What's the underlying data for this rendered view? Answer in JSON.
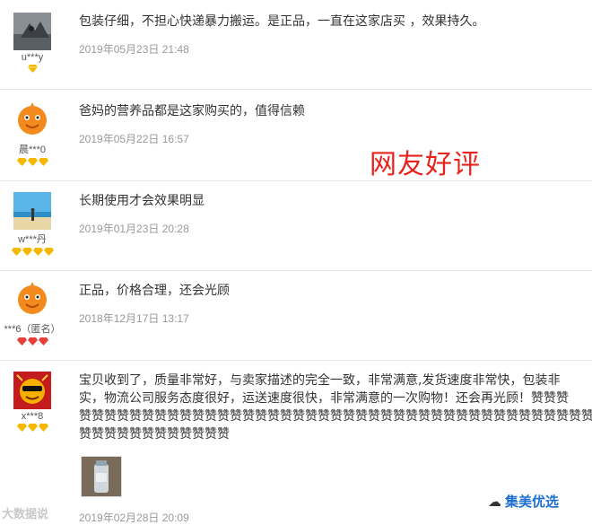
{
  "reviews": [
    {
      "username": "u***y",
      "content": "包装仔细，不担心快递暴力搬运。是正品，一直在这家店买 ，效果持久。",
      "date": "2019年05月23日 21:48",
      "badge_count": 1,
      "badge_color": "#f5b800",
      "avatar": "photo-avatar"
    },
    {
      "username": "晨***0",
      "content": "爸妈的营养品都是这家购买的，值得信赖",
      "date": "2019年05月22日 16:57",
      "badge_count": 3,
      "badge_color": "#f5b800",
      "avatar": "orange-mascot-avatar"
    },
    {
      "username": "w***丹",
      "content": "长期使用才会效果明显",
      "date": "2019年01月23日 20:28",
      "badge_count": 4,
      "badge_color": "#f5b800",
      "avatar": "beach-photo-avatar"
    },
    {
      "username": "***6（匿名）",
      "content": "正品，价格合理，还会光顾",
      "date": "2018年12月17日 13:17",
      "badge_count": 3,
      "badge_color": "#e8403a",
      "avatar": "orange-mascot-avatar"
    },
    {
      "username": "x***8",
      "content_lines": [
        "宝贝收到了，质量非常好，与卖家描述的完全一致，非常满意,发货速度非常快，包装非",
        "实，物流公司服务态度很好，运送速度很快，非常满意的一次购物！还会再光顾！赞赞赞",
        "赞赞赞赞赞赞赞赞赞赞赞赞赞赞赞赞赞赞赞赞赞赞赞赞赞赞赞赞赞赞赞赞赞赞赞赞赞赞赞赞赞赞赞",
        "赞赞赞赞赞赞赞赞赞赞赞赞"
      ],
      "date": "2019年02月28日 20:09",
      "badge_count": 3,
      "badge_color": "#f5b800",
      "avatar": "cartoon-sunglasses-avatar"
    }
  ],
  "overlay_label": "网友好评",
  "watermark_left": "大数据说",
  "watermark_right": "集美优选",
  "colors": {
    "overlay": "#e8231d",
    "date": "#999999",
    "divider": "#e6e6e6"
  }
}
